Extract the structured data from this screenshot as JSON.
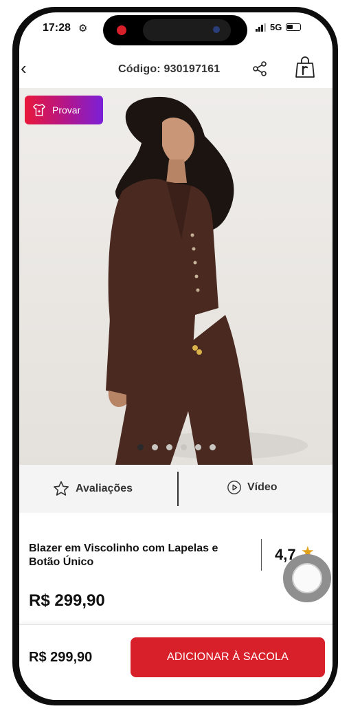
{
  "status_bar": {
    "time": "17:28",
    "network": "5G"
  },
  "header": {
    "code": "Código: 930197161",
    "icons": [
      "back-icon",
      "share-icon",
      "shopping-bag-icon"
    ]
  },
  "try_on": {
    "label": "Provar"
  },
  "carousel": {
    "total": 6,
    "active_index": 0
  },
  "tabs": {
    "reviews": "Avaliações",
    "video": "Vídeo"
  },
  "product": {
    "title": "Blazer em Viscolinho com Lapelas e Botão Único",
    "rating": "4,7",
    "price": "R$ 299,90"
  },
  "footer": {
    "price": "R$ 299,90",
    "add_to_bag": "ADICIONAR À SACOLA"
  },
  "colors": {
    "primary_red": "#d8202a",
    "star": "#e0a21b",
    "try_on_gradient_start": "#e8183a",
    "try_on_gradient_end": "#7b20d8"
  }
}
